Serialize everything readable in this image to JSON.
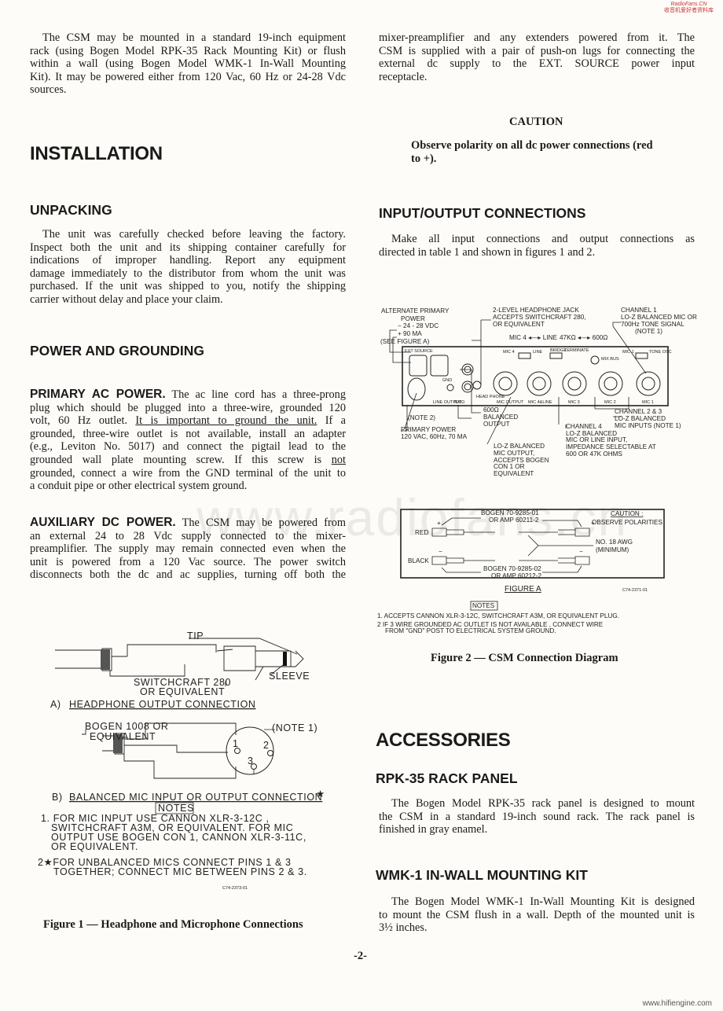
{
  "watermark_top": {
    "line1": "RadioFans.CN",
    "line2": "收音机爱好者资料库"
  },
  "watermark_center": "www.radiofans.cn",
  "watermark_bottom": "www.hifiengine.com",
  "page_number": "-2-",
  "left": {
    "intro": [
      "The CSM may be mounted in a standard 19-inch equipment",
      "rack (using Bogen Model RPK-35 Rack Mounting Kit) or flush",
      "within a wall (using Bogen Model WMK-1 In-Wall Mounting",
      "Kit). It may be powered either from 120 Vac, 60 Hz or 24-28 Vdc",
      "sources."
    ],
    "installation": "INSTALLATION",
    "unpacking": {
      "title": "UNPACKING",
      "lines": [
        "The unit was carefully checked before leaving the factory.",
        "Inspect both the unit and its shipping container carefully for",
        "indications of improper handling. Report any equipment",
        "damage immediately to the distributor from whom the unit was",
        "purchased. If the unit was shipped to you, notify the shipping",
        "carrier without delay and place your claim."
      ]
    },
    "power": {
      "title": "POWER AND GROUNDING",
      "primary_title": "PRIMARY AC POWER.",
      "primary_lines": [
        "The ac line cord has a three-prong",
        "plug which should be plugged into a three-wire, grounded 120",
        "volt, 60 Hz outlet.",
        "It is important to ground the unit.",
        "If a",
        "grounded, three-wire outlet is not available, install an adapter",
        "(e.g., Leviton No. 5017) and connect the pigtail lead to the",
        "grounded wall plate mounting screw. If this screw is",
        "not",
        "grounded, connect a wire from the GND terminal of the unit to",
        "a conduit pipe or other electrical system ground."
      ],
      "aux_title": "AUXILIARY DC POWER.",
      "aux_lines": [
        "The CSM may be powered from",
        "an external 24 to 28 Vdc supply connected to the mixer-",
        "preamplifier. The supply may remain connected even when the",
        "unit is powered from a 120 Vac source. The power switch",
        "disconnects both the dc and ac supplies, turning off both the"
      ]
    },
    "figure1": {
      "tip": "TIP",
      "sleeve": "SLEEVE",
      "switchcraft": "SWITCHCRAFT 280",
      "or_equivalent": "OR EQUIVALENT",
      "a_label": "A)",
      "a_title": "HEADPHONE OUTPUT CONNECTION",
      "bogen": "BOGEN 1008 OR",
      "bogen2": "EQUIVALENT",
      "note1": "(NOTE 1)",
      "pin1": "1",
      "pin2": "2",
      "pin3": "3",
      "b_label": "B)",
      "b_title": "BALANCED MIC INPUT OR OUTPUT CONNECTION",
      "star": "★",
      "notes_title": "NOTES",
      "notes": [
        "1. FOR MIC INPUT USE CANNON XLR-3-12C ,",
        "SWITCHCRAFT A3M, OR EQUIVALENT. FOR MIC",
        "OUTPUT USE BOGEN CON 1, CANNON XLR-3-11C,",
        "OR EQUIVALENT.",
        "2★FOR UNBALANCED MICS CONNECT PINS 1 & 3",
        "TOGETHER; CONNECT MIC BETWEEN PINS 2 & 3."
      ],
      "code": "C74-2373-01",
      "caption": "Figure 1 — Headphone and Microphone Connections"
    }
  },
  "right": {
    "intro": [
      "mixer-preamplifier and any extenders powered from it. The",
      "CSM is supplied with a pair of push-on lugs for connecting the",
      "external dc supply to the EXT. SOURCE power input",
      "receptacle."
    ],
    "caution_title": "CAUTION",
    "caution_lines": [
      "Observe polarity on all dc power connections (red",
      "to +)."
    ],
    "io": {
      "title": "INPUT/OUTPUT CONNECTIONS",
      "lines": [
        "Make all input connections and output connections as",
        "directed in table 1 and shown in figures 1 and 2."
      ]
    },
    "figure2": {
      "alt_power": [
        "ALTERNATE PRIMARY",
        "POWER",
        "−  24 - 28 VDC",
        "+  90 MA",
        "(SEE FIGURE A)"
      ],
      "headphone": [
        "2-LEVEL HEADPHONE JACK",
        "ACCEPTS SWITCHCRAFT 280,",
        "OR EQUIVALENT"
      ],
      "channel1": [
        "CHANNEL 1",
        "LO-Z BALANCED MIC OR",
        "700Hz TONE SIGNAL",
        "(NOTE 1)"
      ],
      "mic_line_switch": "MIC 4 ◂—▸ LINE",
      "imp_switch": "47KΩ ◂—▸ 600Ω",
      "panel": {
        "ext_source": "EXT SOURCE",
        "mic4": "MIC 4",
        "line": "LINE",
        "bridge": "BRIDGE",
        "terminate": "TERMINATE",
        "mic1": "MIC 1",
        "tone_osc": "TONE OSC",
        "mix_bus": "MIX BUS",
        "gnd": "GND",
        "line_output": "LINE OUTPUT",
        "ohm600": "600Ω",
        "head_phone": "HEAD PHONE",
        "mic_output": "MIC OUTPUT",
        "mic4_line": "MIC 4&LINE",
        "mic3": "MIC 3",
        "mic2": "MIC 2",
        "mic1b": "MIC 1"
      },
      "note2": "(NOTE 2)",
      "balanced_out": [
        "600Ω",
        "BALANCED",
        "OUTPUT"
      ],
      "primary_power": [
        "PRIMARY POWER",
        "120 VAC, 60Hz, 70 MA"
      ],
      "mic_out": [
        "LO-Z BALANCED",
        "MIC OUTPUT,",
        "ACCEPTS BOGEN",
        "CON 1 OR",
        "EQUIVALENT"
      ],
      "channel4": [
        "CHANNEL 4",
        "LO-Z BALANCED",
        "MIC OR LINE INPUT,",
        "IMPEDANCE SELECTABLE AT",
        "600 OR 47K OHMS"
      ],
      "channel23": [
        "CHANNEL 2 & 3",
        "LO-Z BALANCED",
        "MIC INPUTS (NOTE 1)"
      ],
      "figA": {
        "bogen1": "BOGEN 70-9285-01",
        "amp1": "OR AMP 60211-2",
        "caution": "CAUTION :",
        "observe": "OBSERVE POLARITIES",
        "red": "RED",
        "black": "BLACK",
        "awg": "NO. 18 AWG",
        "minimum": "(MINIMUM)",
        "bogen2": "BOGEN 70-9285-02",
        "amp2": "OR AMP 60212-2",
        "plus": "+",
        "minus": "−"
      },
      "figure_a": "FIGURE  A",
      "code": "C74-2371-01",
      "notes_title": "NOTES",
      "notes": [
        "1. ACCEPTS CANNON XLR-3-12C, SWITCHCRAFT A3M, OR EQUIVALENT PLUG.",
        "2  IF 3 WIRE GROUNDED AC OUTLET IS NOT AVAILABLE , CONNECT WIRE",
        "FROM \"GND\" POST TO ELECTRICAL SYSTEM GROUND."
      ],
      "caption": "Figure 2 — CSM Connection Diagram"
    },
    "accessories": "ACCESSORIES",
    "rpk": {
      "title": "RPK-35 RACK PANEL",
      "lines": [
        "The Bogen Model RPK-35 rack panel is designed to mount",
        "the CSM in a standard 19-inch sound rack. The rack panel is",
        "finished in gray enamel."
      ]
    },
    "wmk": {
      "title": "WMK-1 IN-WALL MOUNTING KIT",
      "lines": [
        "The Bogen Model WMK-1 In-Wall Mounting Kit is designed",
        "to mount the CSM flush in a wall. Depth of the mounted unit is",
        "3½ inches."
      ]
    }
  }
}
